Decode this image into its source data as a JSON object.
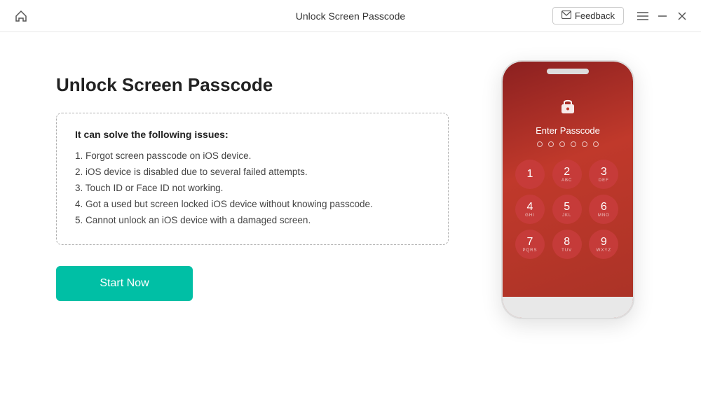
{
  "titlebar": {
    "title": "Unlock Screen Passcode",
    "feedback_label": "Feedback",
    "minimize_label": "—",
    "maximize_label": "☐",
    "close_label": "✕"
  },
  "main": {
    "page_title": "Unlock Screen Passcode",
    "issues_box": {
      "heading": "It can solve the following issues:",
      "items": [
        "1. Forgot screen passcode on iOS device.",
        "2. iOS device is disabled due to several failed attempts.",
        "3. Touch ID or Face ID not working.",
        "4. Got a used but screen locked iOS device without knowing passcode.",
        "5. Cannot unlock an iOS device with a damaged screen."
      ]
    },
    "start_button": "Start Now"
  },
  "phone": {
    "enter_passcode": "Enter Passcode",
    "numpad": [
      {
        "num": "1",
        "alpha": ""
      },
      {
        "num": "2",
        "alpha": "ABC"
      },
      {
        "num": "3",
        "alpha": "DEF"
      },
      {
        "num": "4",
        "alpha": "GHI"
      },
      {
        "num": "5",
        "alpha": "JKL"
      },
      {
        "num": "6",
        "alpha": "MNO"
      },
      {
        "num": "7",
        "alpha": "PQRS"
      },
      {
        "num": "8",
        "alpha": "TUV"
      },
      {
        "num": "9",
        "alpha": "WXYZ"
      }
    ]
  },
  "icons": {
    "home": "⌂",
    "email": "✉",
    "lock": "🔒"
  }
}
